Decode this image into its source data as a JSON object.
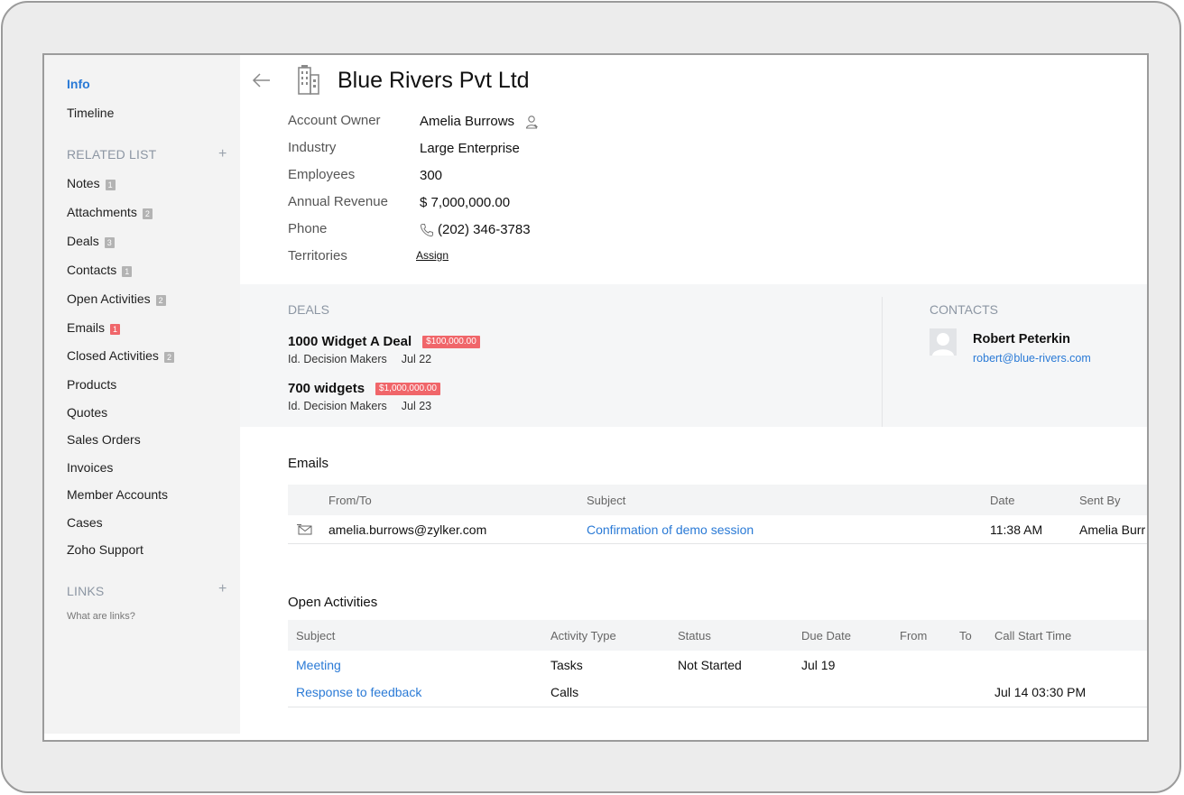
{
  "sidebar": {
    "info": "Info",
    "timeline": "Timeline",
    "related_heading": "RELATED LIST",
    "related": [
      {
        "label": "Notes",
        "count": "1"
      },
      {
        "label": "Attachments",
        "count": "2"
      },
      {
        "label": "Deals",
        "count": "3"
      },
      {
        "label": "Contacts",
        "count": "1"
      },
      {
        "label": "Open Activities",
        "count": "2"
      },
      {
        "label": "Emails",
        "count": "1"
      },
      {
        "label": "Closed Activities",
        "count": "2"
      },
      {
        "label": "Products"
      },
      {
        "label": "Quotes"
      },
      {
        "label": "Sales Orders"
      },
      {
        "label": "Invoices"
      },
      {
        "label": "Member Accounts"
      },
      {
        "label": "Cases"
      },
      {
        "label": "Zoho Support"
      }
    ],
    "links_heading": "LINKS",
    "links_help": "What are links?",
    "plus": "+"
  },
  "account": {
    "name": "Blue Rivers Pvt Ltd",
    "fields": [
      {
        "label": "Account Owner",
        "value": "Amelia Burrows"
      },
      {
        "label": "Industry",
        "value": "Large Enterprise"
      },
      {
        "label": "Employees",
        "value": "300"
      },
      {
        "label": "Annual Revenue",
        "value": "$ 7,000,000.00"
      },
      {
        "label": "Phone",
        "value": "(202) 346-3783"
      },
      {
        "label": "Territories",
        "value": "Assign"
      }
    ]
  },
  "deals": {
    "heading": "DEALS",
    "items": [
      {
        "name": "1000 Widget A Deal",
        "amount": "$100,000.00",
        "stage": "Id. Decision Makers",
        "date": "Jul 22"
      },
      {
        "name": "700 widgets",
        "amount": "$1,000,000.00",
        "stage": "Id. Decision Makers",
        "date": "Jul 23"
      }
    ]
  },
  "contacts": {
    "heading": "CONTACTS",
    "name": "Robert Peterkin",
    "email": "robert@blue-rivers.com"
  },
  "emails": {
    "title": "Emails",
    "columns": [
      "From/To",
      "Subject",
      "Date",
      "Sent By"
    ],
    "rows": [
      {
        "from": "amelia.burrows@zylker.com",
        "subject": "Confirmation of demo session",
        "date": "11:38 AM",
        "sent_by": "Amelia Burr"
      }
    ]
  },
  "activities": {
    "title": "Open Activities",
    "columns": [
      "Subject",
      "Activity Type",
      "Status",
      "Due Date",
      "From",
      "To",
      "Call Start Time"
    ],
    "rows": [
      {
        "subject": "Meeting",
        "type": "Tasks",
        "status": "Not Started",
        "due": "Jul 19",
        "call_start": ""
      },
      {
        "subject": "Response to feedback",
        "type": "Calls",
        "status": "",
        "due": "",
        "call_start": "Jul 14 03:30 PM"
      }
    ]
  },
  "colors": {
    "accent": "#2a7ad6",
    "badge_red": "#f0666a",
    "sidebar_bg": "#f3f3f3"
  }
}
